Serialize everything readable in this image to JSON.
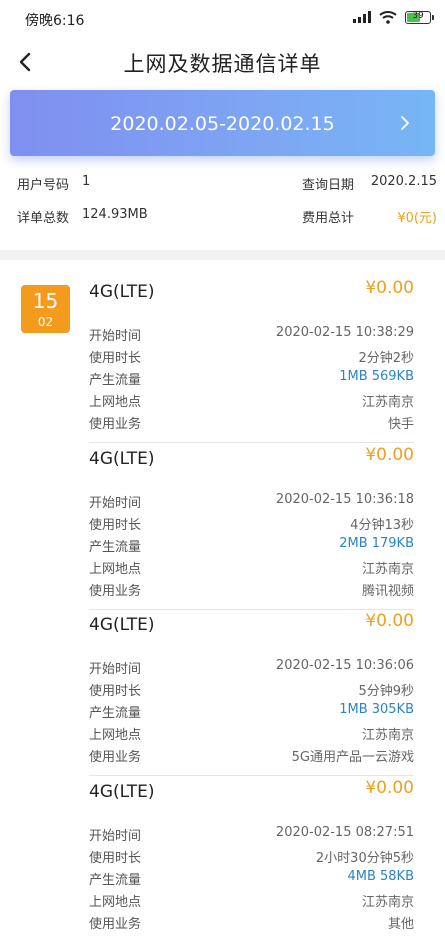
{
  "status_bar": {
    "time": "傍晚6:16",
    "battery": "39"
  },
  "header": {
    "title": "上网及数据通信详单"
  },
  "date_banner": {
    "range": "2020.02.05-2020.02.15"
  },
  "summary": {
    "user_number_label": "用户号码",
    "user_number_value": "1",
    "query_date_label": "查询日期",
    "query_date_value": "2020.2.15",
    "total_label": "详单总数",
    "total_value": "124.93MB",
    "fee_label": "费用总计",
    "fee_value": "¥0(元)"
  },
  "day_group": {
    "day": "15",
    "month": "02"
  },
  "field_labels": {
    "start_time": "开始时间",
    "duration": "使用时长",
    "traffic": "产生流量",
    "location": "上网地点",
    "service": "使用业务"
  },
  "records": [
    {
      "type": "4G(LTE)",
      "amount": "¥0.00",
      "start_time": "2020-02-15 10:38:29",
      "duration": "2分钟2秒",
      "traffic": "1MB 569KB",
      "location": "江苏南京",
      "service": "快手"
    },
    {
      "type": "4G(LTE)",
      "amount": "¥0.00",
      "start_time": "2020-02-15 10:36:18",
      "duration": "4分钟13秒",
      "traffic": "2MB 179KB",
      "location": "江苏南京",
      "service": "腾讯视频"
    },
    {
      "type": "4G(LTE)",
      "amount": "¥0.00",
      "start_time": "2020-02-15 10:36:06",
      "duration": "5分钟9秒",
      "traffic": "1MB 305KB",
      "location": "江苏南京",
      "service": "5G通用产品一云游戏"
    },
    {
      "type": "4G(LTE)",
      "amount": "¥0.00",
      "start_time": "2020-02-15 08:27:51",
      "duration": "2小时30分钟5秒",
      "traffic": "4MB 58KB",
      "location": "江苏南京",
      "service": "其他"
    }
  ],
  "colors": {
    "accent_orange": "#f49a1d",
    "amount_orange": "#f0a020",
    "traffic_blue": "#2a84c9",
    "banner_gradient": [
      "#7f8ff0",
      "#76b6f6"
    ]
  },
  "icons": {
    "back": "chevron-left-icon",
    "banner": "chevron-right-icon",
    "wifi": "wifi-icon",
    "signal": "signal-icon",
    "battery": "battery-icon"
  }
}
